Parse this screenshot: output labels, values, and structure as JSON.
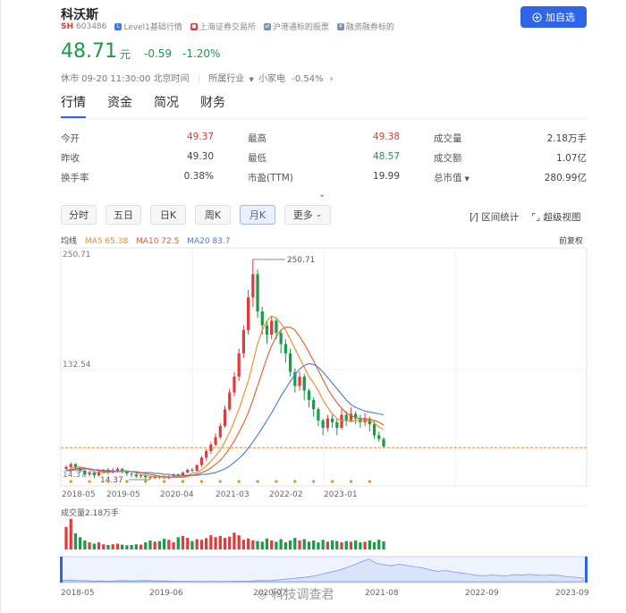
{
  "stock": {
    "name": "科沃斯",
    "market": "SH",
    "code": "603486",
    "tags": [
      "Level1基础行情",
      "上海证券交易所",
      "沪港通标的股票",
      "融资融券标的"
    ],
    "price": "48.71",
    "unit": "元",
    "change": "-0.59",
    "change_pct": "-1.20%",
    "status_time": "休市 09-20 11:30:00 北京时间",
    "industry_label": "所属行业",
    "industry": "小家电",
    "industry_change": "-0.54%"
  },
  "add_button": "加自选",
  "tabs": [
    "行情",
    "资金",
    "简况",
    "财务"
  ],
  "quote": {
    "open_label": "今开",
    "open": "49.37",
    "prev_label": "昨收",
    "prev": "49.30",
    "turnover_label": "换手率",
    "turnover": "0.38%",
    "high_label": "最高",
    "high": "49.38",
    "low_label": "最低",
    "low": "48.57",
    "pe_label": "市盈(TTM)",
    "pe": "19.99",
    "volume_label": "成交量",
    "volume": "2.18万手",
    "amount_label": "成交额",
    "amount": "1.07亿",
    "mcap_label": "总市值",
    "mcap": "280.99亿"
  },
  "periods": [
    "分时",
    "五日",
    "日K",
    "周K",
    "月K",
    "更多"
  ],
  "tools": [
    "区间统计",
    "超级视图"
  ],
  "ma_legend": {
    "label": "均线",
    "ma5": "MA5 65.38",
    "ma10": "MA10 72.5",
    "ma20": "MA20 83.7",
    "adjust": "前复权"
  },
  "colors": {
    "up": "#e23b3b",
    "down": "#1a9a4a",
    "accent": "#2e64e6",
    "ma5": "#f08a24",
    "ma10": "#e85b2a",
    "ma20": "#4a78e0"
  },
  "chart_data": {
    "type": "candlestick",
    "y_ticks": [
      "250.71",
      "132.54",
      "14.37"
    ],
    "max_label": "250.71",
    "min_label": "14.37",
    "x_ticks": [
      "2018-05",
      "2019-05",
      "2020-04",
      "2021-03",
      "2022-02",
      "2023-01"
    ],
    "candles": [
      [
        26,
        28,
        24,
        30
      ],
      [
        28,
        31,
        26,
        33
      ],
      [
        31,
        27,
        25,
        32
      ],
      [
        27,
        24,
        22,
        28
      ],
      [
        24,
        20,
        17,
        25
      ],
      [
        20,
        22,
        18,
        24
      ],
      [
        22,
        19,
        16,
        23
      ],
      [
        19,
        23,
        18,
        25
      ],
      [
        23,
        25,
        21,
        26
      ],
      [
        25,
        22,
        20,
        27
      ],
      [
        22,
        24,
        21,
        27
      ],
      [
        24,
        26,
        22,
        28
      ],
      [
        26,
        23,
        21,
        27
      ],
      [
        23,
        21,
        18,
        24
      ],
      [
        21,
        20,
        17,
        22
      ],
      [
        20,
        18,
        16,
        21
      ],
      [
        18,
        19,
        16,
        20
      ],
      [
        19,
        17,
        15,
        20
      ],
      [
        17,
        16,
        14.37,
        18
      ],
      [
        16,
        18,
        15,
        19
      ],
      [
        18,
        17,
        15,
        19
      ],
      [
        17,
        16,
        15,
        18
      ],
      [
        16,
        18,
        15,
        19
      ],
      [
        18,
        20,
        17,
        21
      ],
      [
        20,
        19,
        17,
        21
      ],
      [
        19,
        22,
        18,
        23
      ],
      [
        22,
        25,
        21,
        26
      ],
      [
        25,
        24,
        22,
        27
      ],
      [
        24,
        30,
        23,
        31
      ],
      [
        30,
        38,
        28,
        40
      ],
      [
        38,
        45,
        35,
        47
      ],
      [
        45,
        52,
        42,
        55
      ],
      [
        52,
        60,
        50,
        64
      ],
      [
        60,
        72,
        58,
        75
      ],
      [
        72,
        90,
        70,
        94
      ],
      [
        90,
        108,
        88,
        112
      ],
      [
        108,
        125,
        104,
        130
      ],
      [
        125,
        150,
        120,
        155
      ],
      [
        150,
        175,
        145,
        180
      ],
      [
        175,
        210,
        170,
        218
      ],
      [
        210,
        235,
        200,
        250.71
      ],
      [
        235,
        195,
        188,
        240
      ],
      [
        195,
        180,
        170,
        200
      ],
      [
        180,
        170,
        160,
        185
      ],
      [
        170,
        185,
        165,
        190
      ],
      [
        185,
        172,
        165,
        188
      ],
      [
        172,
        160,
        150,
        176
      ],
      [
        160,
        150,
        140,
        165
      ],
      [
        150,
        130,
        125,
        155
      ],
      [
        130,
        115,
        108,
        134
      ],
      [
        115,
        125,
        110,
        130
      ],
      [
        125,
        110,
        100,
        128
      ],
      [
        110,
        100,
        92,
        112
      ],
      [
        100,
        90,
        82,
        103
      ],
      [
        90,
        78,
        72,
        92
      ],
      [
        78,
        70,
        62,
        80
      ],
      [
        70,
        80,
        66,
        84
      ],
      [
        80,
        76,
        70,
        84
      ],
      [
        76,
        70,
        62,
        80
      ],
      [
        70,
        84,
        68,
        90
      ],
      [
        84,
        78,
        72,
        88
      ],
      [
        78,
        85,
        76,
        92
      ],
      [
        85,
        80,
        74,
        88
      ],
      [
        80,
        76,
        70,
        84
      ],
      [
        76,
        80,
        72,
        86
      ],
      [
        80,
        74,
        66,
        82
      ],
      [
        74,
        62,
        58,
        78
      ],
      [
        62,
        58,
        55,
        66
      ],
      [
        58,
        50,
        48.57,
        60
      ]
    ],
    "ma5": [
      24,
      26,
      28,
      28,
      27,
      25,
      23,
      22,
      22,
      22,
      23,
      23,
      24,
      24,
      23,
      22,
      20,
      19,
      18,
      17,
      17,
      17,
      17,
      17,
      18,
      18,
      19,
      21,
      22,
      25,
      29,
      34,
      40,
      46,
      55,
      65,
      77,
      90,
      105,
      120,
      140,
      160,
      175,
      185,
      190,
      188,
      182,
      175,
      165,
      155,
      145,
      135,
      125,
      118,
      110,
      100,
      92,
      85,
      80,
      78,
      78,
      77,
      78,
      78,
      78,
      78,
      75,
      71,
      68
    ],
    "ma10": [
      24,
      25,
      26,
      27,
      27,
      26,
      25,
      24,
      23,
      23,
      23,
      23,
      23,
      23,
      23,
      22,
      22,
      21,
      20,
      19,
      18,
      18,
      17,
      17,
      17,
      17,
      18,
      19,
      20,
      22,
      24,
      27,
      31,
      35,
      41,
      48,
      56,
      65,
      75,
      86,
      100,
      115,
      130,
      145,
      158,
      168,
      175,
      178,
      178,
      175,
      168,
      160,
      151,
      142,
      132,
      122,
      112,
      104,
      97,
      91,
      86,
      83,
      81,
      80,
      80,
      79,
      78,
      76,
      73
    ],
    "ma20": [
      24,
      24,
      25,
      25,
      26,
      26,
      25,
      25,
      24,
      24,
      24,
      23,
      23,
      23,
      23,
      23,
      22,
      22,
      22,
      21,
      21,
      20,
      20,
      19,
      19,
      19,
      19,
      19,
      19,
      20,
      20,
      21,
      22,
      24,
      26,
      29,
      33,
      37,
      42,
      48,
      55,
      62,
      70,
      78,
      86,
      95,
      104,
      112,
      120,
      127,
      133,
      137,
      139,
      138,
      135,
      130,
      124,
      118,
      112,
      106,
      100,
      95,
      92,
      90,
      88,
      87,
      86,
      85,
      84
    ],
    "volume": [
      70,
      95,
      50,
      38,
      28,
      22,
      18,
      22,
      16,
      14,
      16,
      18,
      15,
      13,
      14,
      16,
      15,
      22,
      28,
      24,
      26,
      33,
      30,
      22,
      38,
      42,
      36,
      26,
      32,
      30,
      35,
      44,
      38,
      42,
      36,
      40,
      52,
      44,
      30,
      34,
      28,
      26,
      24,
      34,
      28,
      24,
      32,
      22,
      28,
      36,
      28,
      32,
      24,
      28,
      22,
      30,
      24,
      28,
      26,
      22,
      26,
      24,
      28,
      22,
      24,
      28,
      22,
      30,
      25
    ],
    "volume_label": "成交量2.18万手",
    "nav_x_ticks": [
      "2018-05",
      "2019-06",
      "2020-07",
      "2021-08",
      "2022-09",
      "2023-09"
    ]
  },
  "watermark": "科技调查君"
}
